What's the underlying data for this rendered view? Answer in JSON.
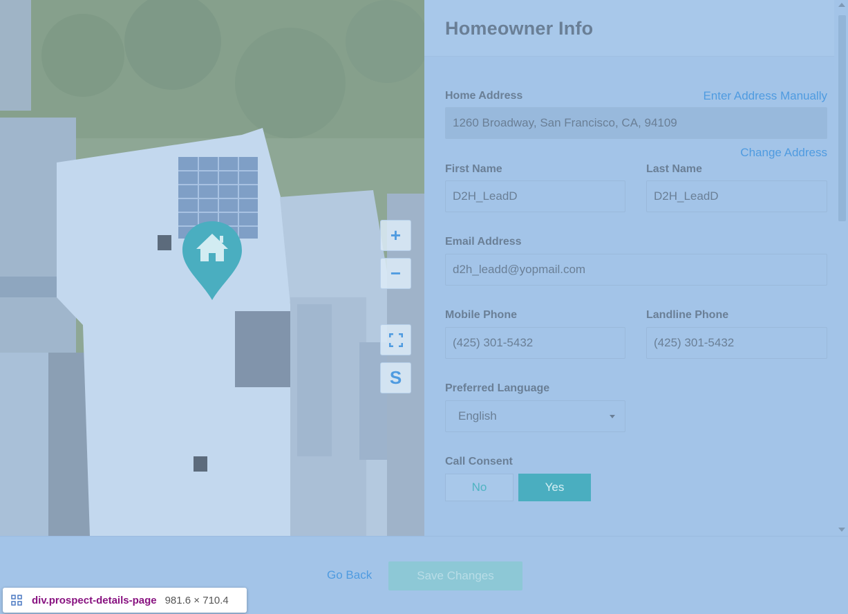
{
  "map": {
    "zoom_in_label": "+",
    "zoom_out_label": "−",
    "satellite_label": "S",
    "pin_icon": "home-icon"
  },
  "panel": {
    "title": "Homeowner Info",
    "home_address": {
      "label": "Home Address",
      "enter_manually_link": "Enter Address Manually",
      "value": "1260 Broadway, San Francisco, CA, 94109",
      "change_link": "Change Address"
    },
    "first_name": {
      "label": "First Name",
      "value": "D2H_LeadD"
    },
    "last_name": {
      "label": "Last Name",
      "value": "D2H_LeadD"
    },
    "email": {
      "label": "Email Address",
      "value": "d2h_leadd@yopmail.com"
    },
    "mobile_phone": {
      "label": "Mobile Phone",
      "value": "(425) 301-5432"
    },
    "landline_phone": {
      "label": "Landline Phone",
      "value": "(425) 301-5432"
    },
    "preferred_language": {
      "label": "Preferred Language",
      "selected": "English"
    },
    "call_consent": {
      "label": "Call Consent",
      "no_label": "No",
      "yes_label": "Yes",
      "selected": "Yes"
    }
  },
  "footer": {
    "go_back": "Go Back",
    "save_changes": "Save Changes"
  },
  "devtools": {
    "selector": "div.prospect-details-page",
    "dimensions": "981.6 × 710.4"
  },
  "colors": {
    "accent": "#4f9be0",
    "teal": "#4aaec0",
    "overlay": "#a3c4e8"
  }
}
